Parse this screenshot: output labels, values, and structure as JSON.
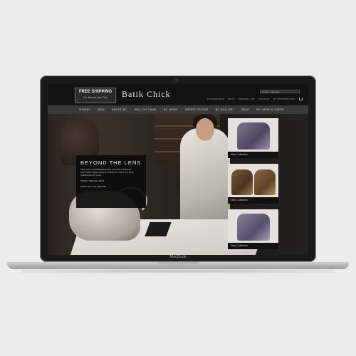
{
  "header": {
    "promo_title": "FREE SHIPPING",
    "promo_sub": "For Jakarta Area Only",
    "logo": "Batik Chick",
    "language_select": "Choose Language",
    "links": [
      "LOGIN/SIGNUP",
      "WAITY",
      "WISHING LIST",
      "CONTACT",
      "MY SHOPPING BAG"
    ]
  },
  "nav": {
    "items": [
      "WOMEN",
      "MEN",
      "ABOUT BC",
      "WALL OF FAME",
      "BC NEWS",
      "ORDER STATUS",
      "BC GALLERY",
      "SALE",
      "BC HERE & THERE"
    ]
  },
  "hero": {
    "title": "BEYOND THE LENS",
    "body": "INEZ VAN LAMSWEERDE AND VINOODH MATADIN CAPTURE THEIR UNIQUE VISION OF THE FALL 2015 CAMPAIGN ON FILM",
    "link1": "WATCH THE FALL FILM",
    "link2": "SHOP FALL COLLECTION"
  },
  "products": [
    {
      "label": "New Collection"
    },
    {
      "label": "New Collection"
    },
    {
      "label": "New Collection"
    }
  ],
  "device": {
    "brand": "MacBook"
  },
  "colors": {
    "header_bg": "#121212",
    "nav_bg": "#3a3a3a",
    "page_bg": "#ececec"
  }
}
